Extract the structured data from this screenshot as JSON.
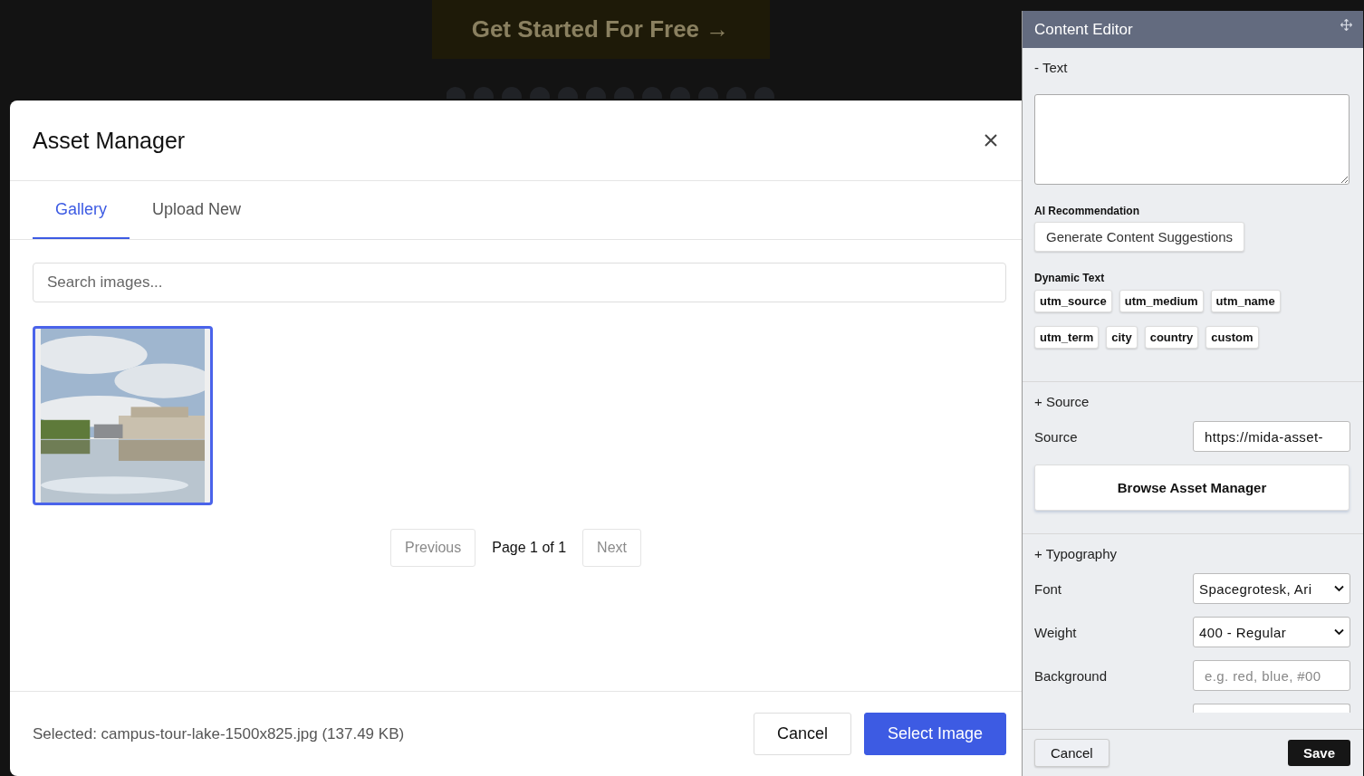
{
  "background_page": {
    "cta_button": "Get Started For Free →"
  },
  "asset_manager": {
    "title": "Asset Manager",
    "tabs": [
      {
        "label": "Gallery",
        "selected": true
      },
      {
        "label": "Upload New",
        "selected": false
      }
    ],
    "search": {
      "placeholder": "Search images..."
    },
    "images": [
      {
        "kind": "picture",
        "selected": true
      }
    ],
    "pagination": {
      "previous": {
        "label": "Previous",
        "disabled": true
      },
      "page": "Page 1 of 1",
      "next": {
        "label": "Next",
        "disabled": true
      }
    },
    "footer": {
      "selected_text": "Selected: campus-tour-lake-1500x825.jpg (137.49 KB)",
      "buttons": [
        {
          "label": "Cancel",
          "kind": "secondary"
        },
        {
          "label": "Select Image",
          "kind": "primary"
        }
      ]
    }
  },
  "content_editor": {
    "title": "Content Editor",
    "text_section": {
      "heading": "- Text",
      "ai_label": "AI Recommendation",
      "ai_button": "Generate Content Suggestions",
      "dynamic_label": "Dynamic Text",
      "chips": [
        "utm_source",
        "utm_medium",
        "utm_name",
        "utm_term",
        "city",
        "country",
        "custom"
      ]
    },
    "source_section": {
      "heading": "+ Source",
      "label": "Source",
      "value": "https://mida-asset-",
      "browse_button": "Browse Asset Manager"
    },
    "typography_section": {
      "heading": "+ Typography",
      "rows": [
        {
          "kind": "select",
          "label": "Font",
          "value": "Spacegrotesk, Ari"
        },
        {
          "kind": "select",
          "label": "Weight",
          "value": "400 - Regular"
        },
        {
          "kind": "input",
          "label": "Background",
          "placeholder": "e.g. red, blue, #00"
        }
      ]
    },
    "footer": {
      "cancel": "Cancel",
      "save": "Save"
    }
  }
}
